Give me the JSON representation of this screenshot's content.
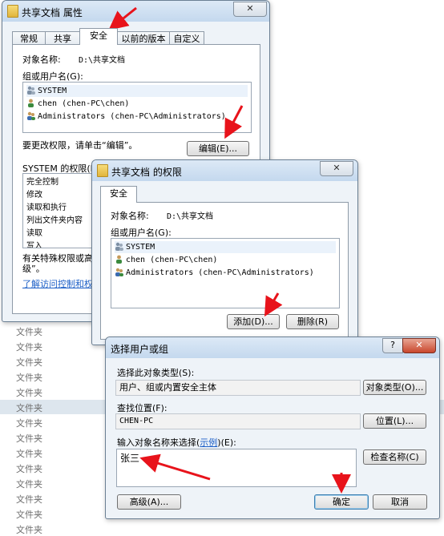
{
  "background": {
    "rows": [
      "文件夹",
      "文件夹",
      "文件夹",
      "文件夹",
      "文件夹",
      "文件夹",
      "文件夹",
      "文件夹",
      "文件夹",
      "文件夹",
      "文件夹",
      "文件夹",
      "文件夹",
      "文件夹"
    ]
  },
  "props_window": {
    "title": "共享文档 属性",
    "tabs": [
      "常规",
      "共享",
      "安全",
      "以前的版本",
      "自定义"
    ],
    "object_label": "对象名称:",
    "object_value": "D:\\共享文档",
    "group_label": "组或用户名(G):",
    "users": [
      "SYSTEM",
      "chen (chen-PC\\chen)",
      "Administrators (chen-PC\\Administrators)"
    ],
    "change_hint": "要更改权限，请单击“编辑”。",
    "edit_button": "编辑(E)...",
    "perm_label": "SYSTEM 的权限(P)",
    "permissions": [
      "完全控制",
      "修改",
      "读取和执行",
      "列出文件夹内容",
      "读取",
      "写入"
    ],
    "special_text_1": "有关特殊权限或高",
    "special_text_2": "级”。",
    "learn_link": "了解访问控制和权"
  },
  "perm_window": {
    "title": "共享文档 的权限",
    "tab": "安全",
    "object_label": "对象名称:",
    "object_value": "D:\\共享文档",
    "group_label": "组或用户名(G):",
    "users": [
      "SYSTEM",
      "chen (chen-PC\\chen)",
      "Administrators (chen-PC\\Administrators)"
    ],
    "add_button": "添加(D)...",
    "remove_button": "删除(R)"
  },
  "select_window": {
    "title": "选择用户或组",
    "help": "?",
    "type_label": "选择此对象类型(S):",
    "type_value": "用户、组或内置安全主体",
    "type_button": "对象类型(O)...",
    "location_label": "查找位置(F):",
    "location_value": "CHEN-PC",
    "location_button": "位置(L)...",
    "enter_label_pre": "输入对象名称来选择(",
    "enter_label_link": "示例",
    "enter_label_post": ")(E):",
    "name_value": "张三",
    "check_button": "检查名称(C)",
    "advanced_button": "高级(A)...",
    "ok_button": "确定",
    "cancel_button": "取消"
  },
  "colors": {
    "arrow": "#e8131b",
    "link": "#1c5fc7",
    "title_bar": "#c4d8ee"
  }
}
